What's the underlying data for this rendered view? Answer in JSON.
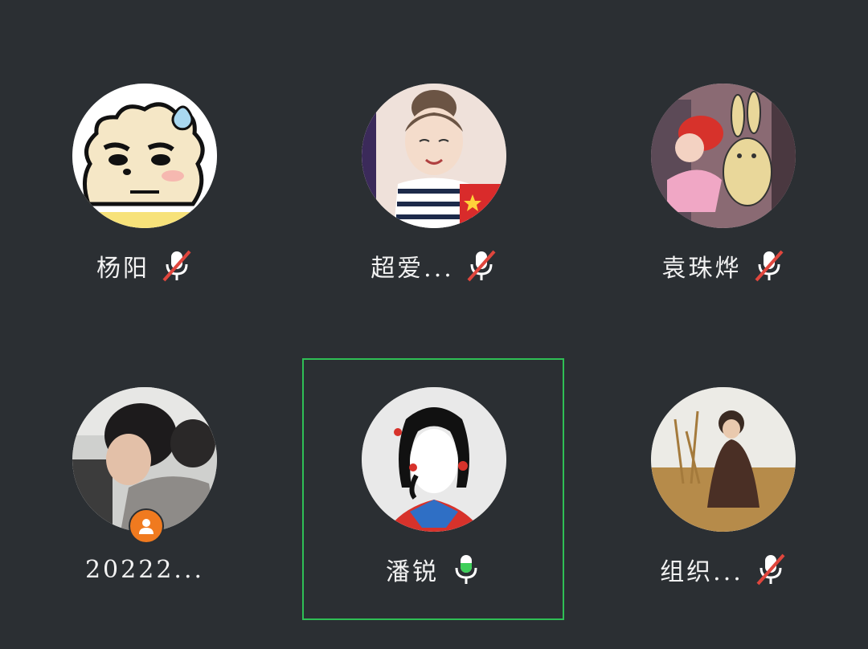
{
  "participants": [
    {
      "name": "杨阳",
      "mic": "muted",
      "mic_icon": "mic-muted-icon",
      "avatar": "cartoon-sheep-avatar"
    },
    {
      "name": "超爱...",
      "mic": "muted",
      "mic_icon": "mic-muted-icon",
      "avatar": "girl-illustration-avatar"
    },
    {
      "name": "袁珠烨",
      "mic": "muted",
      "mic_icon": "mic-muted-icon",
      "avatar": "crayon-shinchan-avatar"
    },
    {
      "name": "20222...",
      "mic": "none",
      "badge_icon": "person-badge-icon",
      "avatar": "photo-avatar"
    },
    {
      "name": "潘锐",
      "mic": "active",
      "mic_icon": "mic-active-icon",
      "avatar": "ink-girl-avatar",
      "speaking": true
    },
    {
      "name": "组织...",
      "mic": "muted",
      "mic_icon": "mic-muted-icon",
      "avatar": "boy-field-avatar"
    }
  ],
  "colors": {
    "background": "#2b2f33",
    "speaking_border": "#2fbf55",
    "mute_slash": "#e0463d",
    "mic_active_level": "#3ecf5a",
    "badge": "#f07a1f"
  }
}
